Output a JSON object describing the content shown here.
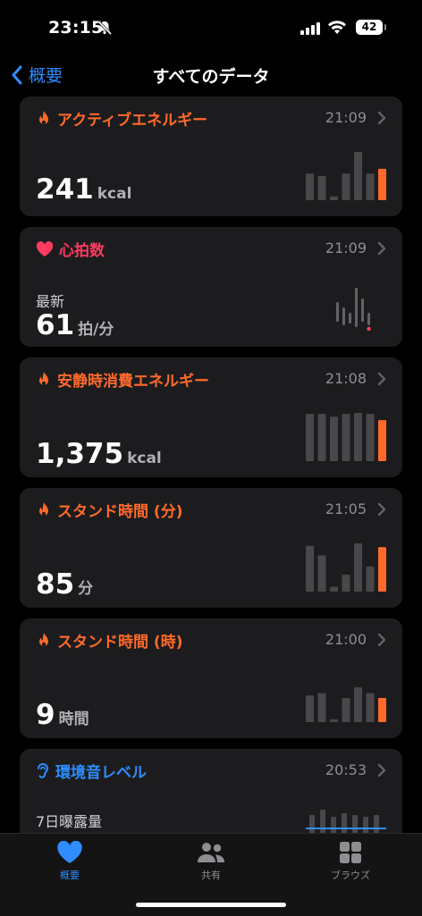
{
  "status_bar": {
    "time": "23:15",
    "battery": "42"
  },
  "nav": {
    "back_label": "概要",
    "title": "すべてのデータ"
  },
  "cards": [
    {
      "title": "アクティブエネルギー",
      "time": "21:09",
      "value": "241",
      "unit": "kcal",
      "bars": [
        0.55,
        0.5,
        0.08,
        0.55,
        1.0,
        0.55,
        0.65
      ]
    },
    {
      "title": "心拍数",
      "time": "21:09",
      "sub": "最新",
      "value": "61",
      "unit": "拍/分"
    },
    {
      "title": "安静時消費エネルギー",
      "time": "21:08",
      "value": "1,375",
      "unit": "kcal",
      "bars": [
        0.98,
        0.98,
        0.92,
        0.98,
        1.0,
        0.98,
        0.85
      ]
    },
    {
      "title": "スタンド時間 (分)",
      "time": "21:05",
      "value": "85",
      "unit": "分",
      "bars": [
        0.95,
        0.75,
        0.1,
        0.35,
        1.0,
        0.52,
        0.92
      ]
    },
    {
      "title": "スタンド時間 (時)",
      "time": "21:00",
      "value": "9",
      "unit": "時間",
      "bars": [
        0.55,
        0.6,
        0.06,
        0.5,
        0.72,
        0.6,
        0.5
      ]
    },
    {
      "title": "環境音レベル",
      "time": "20:53",
      "sub": "7日曝露量"
    }
  ],
  "tabs": [
    {
      "label": "概要",
      "icon": "heart-icon"
    },
    {
      "label": "共有",
      "icon": "people-icon"
    },
    {
      "label": "ブラウズ",
      "icon": "grid-icon"
    }
  ],
  "colors": {
    "accent": "#2f8dff",
    "activity": "#ff6a2b",
    "heart": "#ff3b5f",
    "card": "#1c1c1e"
  }
}
